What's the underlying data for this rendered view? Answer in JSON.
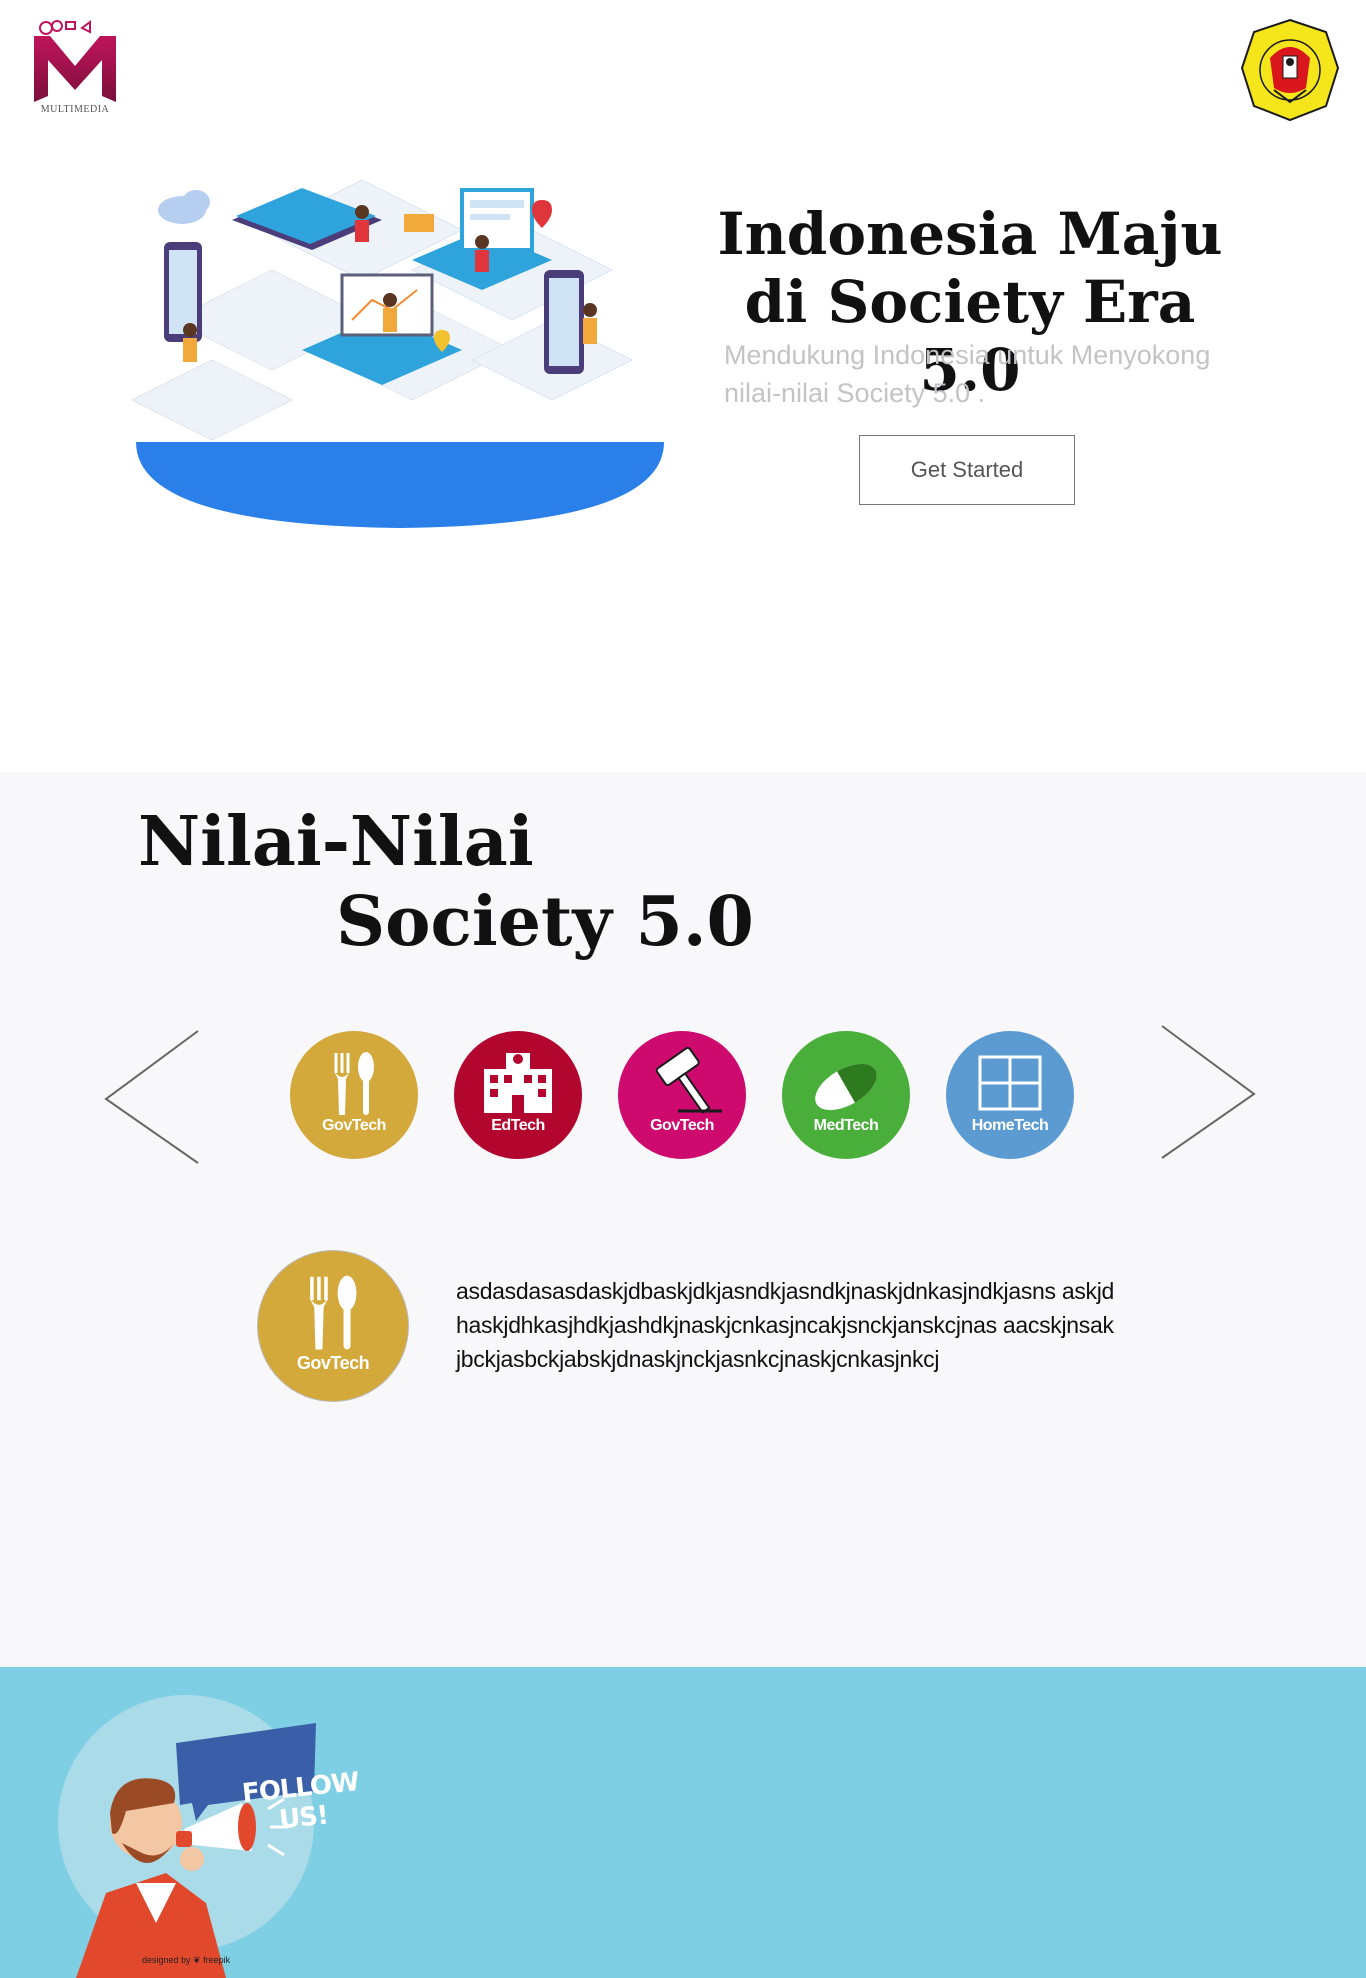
{
  "header": {
    "left_logo_caption": "MULTIMEDIA",
    "right_logo_text": "UNIVERSITAS PEMBANGUNAN NASIONAL VETERAN JAKARTA"
  },
  "hero": {
    "title_line1": "Indonesia Maju",
    "title_line2": "di Society Era 5.0",
    "subtitle": "Mendukung Indonesia untuk Menyokong nilai-nilai  Society 5.0 .",
    "cta_label": "Get Started",
    "accent_color": "#2a80e8"
  },
  "values": {
    "title_line1": "Nilai-Nilai",
    "title_line2": "Society 5.0",
    "categories": [
      {
        "label": "GovTech",
        "icon": "fork-spoon-icon",
        "color": "#d4a93c"
      },
      {
        "label": "EdTech",
        "icon": "building-icon",
        "color": "#b2062e"
      },
      {
        "label": "GovTech",
        "icon": "gavel-icon",
        "color": "#cf0a6f"
      },
      {
        "label": "MedTech",
        "icon": "pill-icon",
        "color": "#4aae3a"
      },
      {
        "label": "HomeTech",
        "icon": "window-icon",
        "color": "#5b9bd2"
      }
    ],
    "selected": {
      "label": "GovTech",
      "icon": "fork-spoon-icon",
      "color": "#d4a93c",
      "description": "asdasdasasdaskjdbaskjdkjasndkjasndkjnaskjdnkasjndkjasns askjdhaskjdhkasjhdkjashdkjnaskjcnkasjncakjsnckjanskcjnas aacskjnsakjbckjasbckjabskjdnaskjnckjasnkcjnaskjcnkasjnkcj"
    }
  },
  "footer": {
    "follow_text": "FOLLOW US!",
    "designed_by": "designed by ❦ freepik",
    "background_color": "#7ecfe4"
  }
}
